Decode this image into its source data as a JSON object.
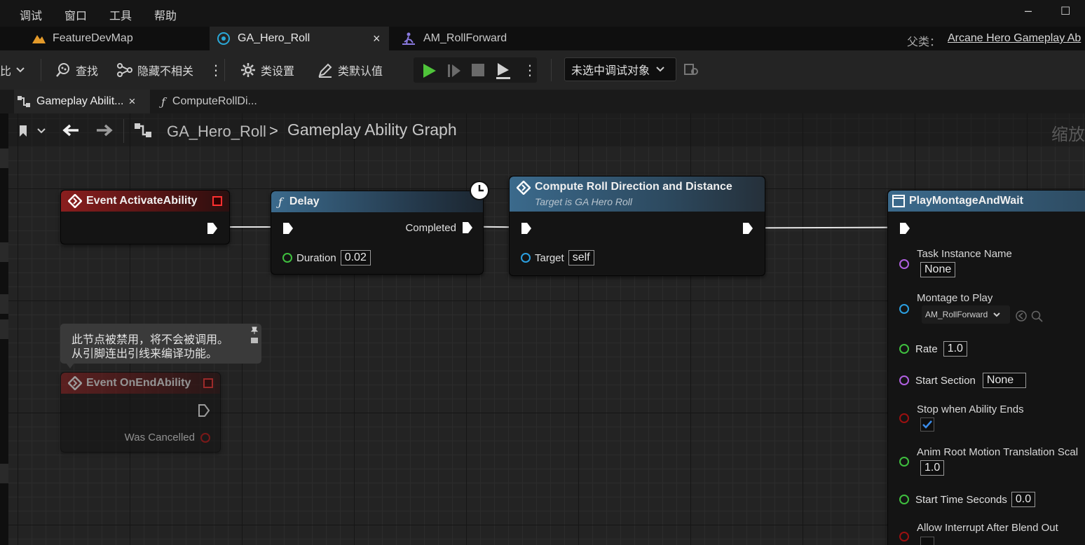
{
  "menu": {
    "items": [
      "调试",
      "窗口",
      "工具",
      "帮助"
    ]
  },
  "window": {
    "minimize": "–",
    "maximize": "☐"
  },
  "tabs": {
    "items": [
      {
        "label": "FeatureDevMap",
        "icon": "map-icon"
      },
      {
        "label": "GA_Hero_Roll",
        "icon": "blueprint-icon",
        "close": "×"
      },
      {
        "label": "AM_RollForward",
        "icon": "anim-montage-icon"
      }
    ],
    "parent_label": "父类：",
    "parent_value": "Arcane Hero Gameplay Ab"
  },
  "toolbar": {
    "diff_label": "比",
    "find_label": "查找",
    "hide_label": "隐藏不相关",
    "class_settings_label": "类设置",
    "class_defaults_label": "类默认值",
    "debug_select": "未选中调试对象"
  },
  "graph_tabs": {
    "items": [
      {
        "label": "Gameplay Abilit...",
        "close": "×"
      },
      {
        "label": "ComputeRollDi..."
      }
    ]
  },
  "breadcrumb": {
    "root": "GA_Hero_Roll",
    "separator": ">",
    "graph": "Gameplay Ability Graph",
    "zoom_label": "缩放"
  },
  "nodes": {
    "activate": {
      "title": "Event ActivateAbility"
    },
    "delay": {
      "title": "Delay",
      "completed": "Completed",
      "duration_label": "Duration",
      "duration_value": "0.02"
    },
    "compute": {
      "title": "Compute Roll Direction and Distance",
      "subtitle": "Target is GA Hero Roll",
      "target_label": "Target",
      "target_value": "self"
    },
    "montage": {
      "title": "PlayMontageAndWait",
      "task_name_label": "Task Instance Name",
      "task_name_value": "None",
      "montage_label": "Montage to Play",
      "montage_value": "AM_RollForward",
      "rate_label": "Rate",
      "rate_value": "1.0",
      "start_section_label": "Start Section",
      "start_section_value": "None",
      "stop_label": "Stop when Ability Ends",
      "root_motion_label": "Anim Root Motion Translation Scal",
      "root_motion_value": "1.0",
      "start_time_label": "Start Time Seconds",
      "start_time_value": "0.0",
      "interrupt_label": "Allow Interrupt After Blend Out"
    },
    "end": {
      "title": "Event OnEndAbility",
      "cancelled_label": "Was Cancelled"
    }
  },
  "comment": {
    "line1": "此节点被禁用，将不会被调用。",
    "line2": "从引脚连出引线来编译功能。"
  },
  "colors": {
    "event_header": "#7a1c1c",
    "function_header": "#2b4f6b",
    "exec_pin": "#ffffff",
    "float_pin": "#3fbf3f",
    "object_pin": "#2b9fe0",
    "name_pin": "#b060e0",
    "bool_pin": "#9b1010"
  }
}
